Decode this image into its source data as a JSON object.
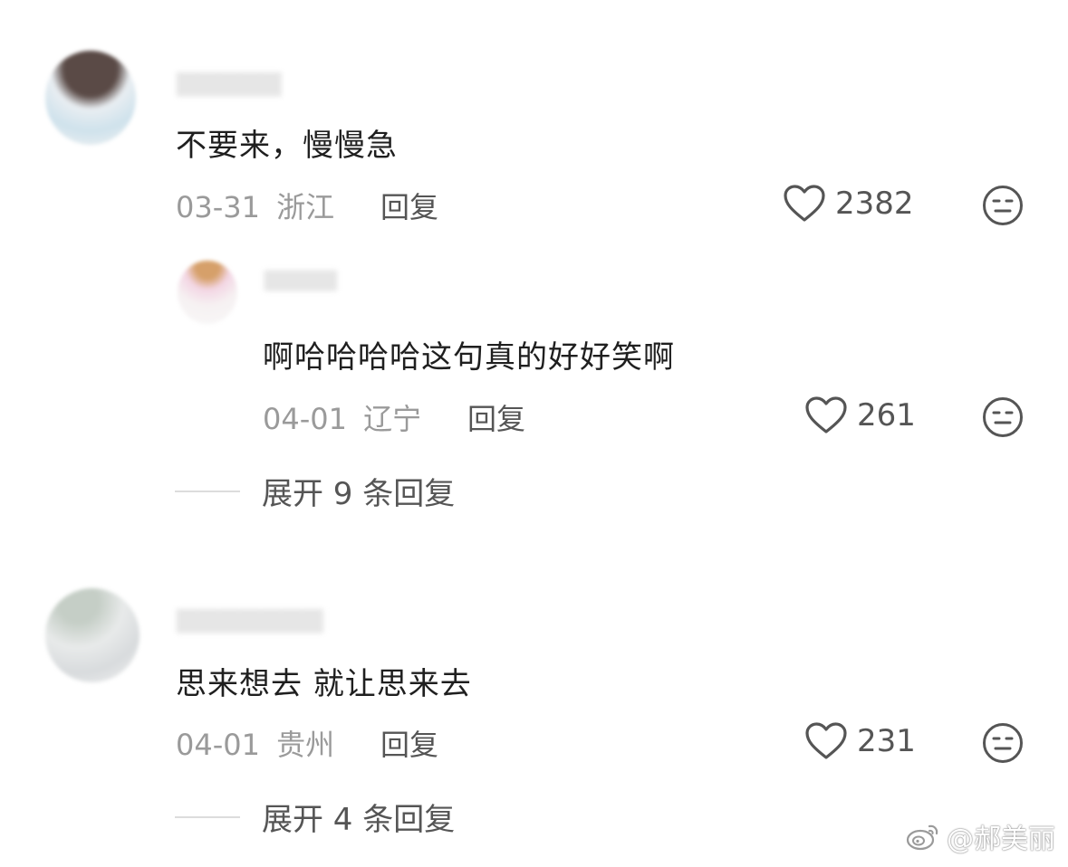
{
  "comments": [
    {
      "text": "不要来，慢慢急",
      "date": "03-31",
      "location": "浙江",
      "reply_label": "回复",
      "likes": "2382",
      "icons": [
        "heart-icon",
        "meh-face-icon"
      ],
      "reply": {
        "text": "啊哈哈哈哈这句真的好好笑啊",
        "date": "04-01",
        "location": "辽宁",
        "reply_label": "回复",
        "likes": "261"
      },
      "expand_label": "展开 9 条回复"
    },
    {
      "text": "思来想去 就让思来去",
      "date": "04-01",
      "location": "贵州",
      "reply_label": "回复",
      "likes": "231",
      "expand_label": "展开 4 条回复"
    }
  ],
  "watermark": {
    "text": "@郝美丽",
    "icon": "weibo-icon"
  },
  "colors": {
    "text": "#1f1f1f",
    "meta": "#9a9a9a",
    "action": "#555555"
  }
}
